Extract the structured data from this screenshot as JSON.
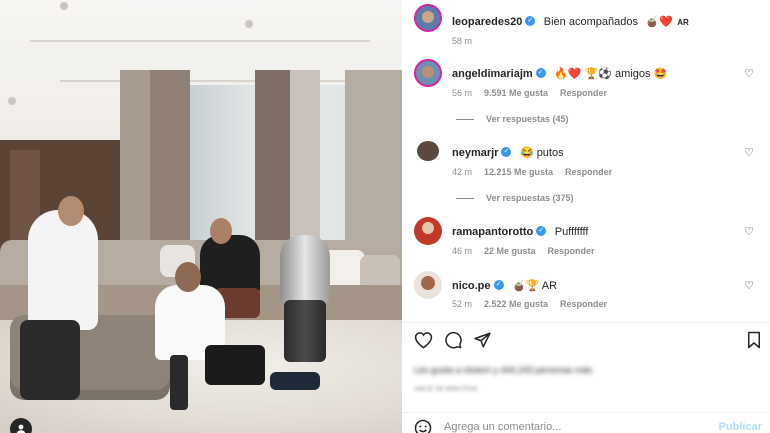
{
  "post": {
    "author": "leoparedes20",
    "caption": "Bien acompañados",
    "caption_emoji": "🧉❤️",
    "caption_flag": "AR",
    "time": "58 m"
  },
  "comments": [
    {
      "username": "angeldimariajm",
      "verified": true,
      "text": "🔥❤️ 🏆⚽ amigos 🤩",
      "time": "56 m",
      "likes": "9.591 Me gusta",
      "reply": "Responder",
      "view_replies": "Ver respuestas (45)"
    },
    {
      "username": "neymarjr",
      "verified": true,
      "text": "😂 putos",
      "time": "42 m",
      "likes": "12.215 Me gusta",
      "reply": "Responder",
      "view_replies": "Ver respuestas (375)"
    },
    {
      "username": "ramapantorotto",
      "verified": true,
      "text": "Pufffffff",
      "time": "46 m",
      "likes": "22 Me gusta",
      "reply": "Responder"
    },
    {
      "username": "nico.pe",
      "verified": true,
      "text": "🧉🏆 AR",
      "time": "52 m",
      "likes": "2.522 Me gusta",
      "reply": "Responder"
    }
  ],
  "likes_summary": "Les gusta a rdubon y 444,243 personas más",
  "time_ago": "HACE 58 MINUTOS",
  "add_comment": {
    "placeholder": "Agrega un comentario...",
    "publish": "Publicar"
  },
  "colors": {
    "verified": "#3897f0",
    "text": "#262626",
    "muted": "#8e8e8e",
    "publish": "#b2dffc"
  },
  "icons": [
    "heart-icon",
    "comment-icon",
    "share-icon",
    "bookmark-icon",
    "emoji-icon",
    "user-tag-icon"
  ]
}
